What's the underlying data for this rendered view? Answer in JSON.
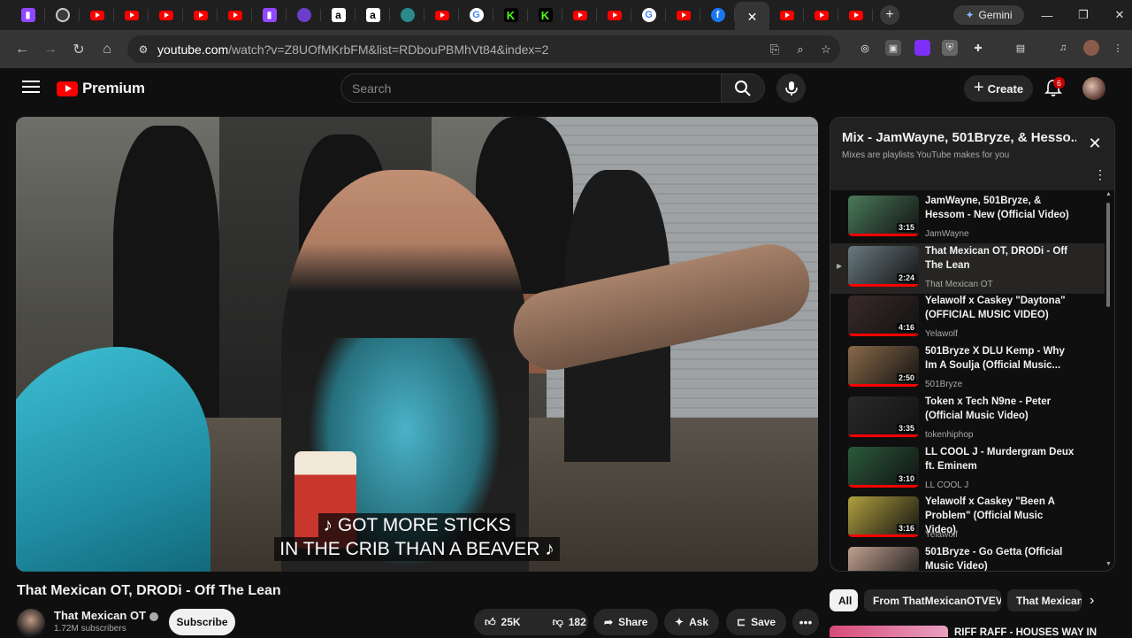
{
  "browser": {
    "tabs": [
      {
        "icon": "twitch-icon"
      },
      {
        "icon": "info-icon"
      },
      {
        "icon": "youtube-icon"
      },
      {
        "icon": "youtube-icon"
      },
      {
        "icon": "youtube-icon"
      },
      {
        "icon": "youtube-icon"
      },
      {
        "icon": "youtube-icon"
      },
      {
        "icon": "twitch-icon"
      },
      {
        "icon": "purple-circle-icon"
      },
      {
        "icon": "amazon-icon"
      },
      {
        "icon": "amazon-icon"
      },
      {
        "icon": "teal-globe-icon"
      },
      {
        "icon": "youtube-icon"
      },
      {
        "icon": "google-icon"
      },
      {
        "icon": "kick-icon"
      },
      {
        "icon": "kick-icon"
      },
      {
        "icon": "youtube-icon"
      },
      {
        "icon": "youtube-icon"
      },
      {
        "icon": "google-icon"
      },
      {
        "icon": "youtube-icon"
      },
      {
        "icon": "facebook-icon"
      }
    ],
    "active_tab_close": "✕",
    "tabs_after": [
      {
        "icon": "youtube-icon"
      },
      {
        "icon": "youtube-icon"
      },
      {
        "icon": "youtube-icon"
      }
    ],
    "new_tab": "+",
    "gemini_label": "Gemini",
    "url_host": "youtube.com",
    "url_rest": "/watch?v=Z8UOfMKrbFM&list=RDbouPBMhVt84&index=2"
  },
  "header": {
    "logo_text": "Premium",
    "search_placeholder": "Search",
    "create_label": "Create",
    "notification_count": "6"
  },
  "video": {
    "caption_line1": "♪ GOT MORE STICKS",
    "caption_line2": "IN THE CRIB THAN A BEAVER ♪",
    "title": "That Mexican OT, DRODi - Off The Lean",
    "channel": "That Mexican OT",
    "subscribers": "1.72M subscribers",
    "subscribe_label": "Subscribe",
    "likes": "25K",
    "dislikes": "182",
    "share_label": "Share",
    "ask_label": "Ask",
    "save_label": "Save"
  },
  "playlist": {
    "title": "Mix - JamWayne, 501Bryze, & Hesso...",
    "subtitle": "Mixes are playlists YouTube makes for you",
    "items": [
      {
        "title": "JamWayne, 501Bryze, & Hessom - New (Official Video)",
        "channel": "JamWayne",
        "duration": "3:15",
        "thumb": "#4a7a5a",
        "current": false
      },
      {
        "title": "That Mexican OT, DRODi - Off The Lean",
        "channel": "That Mexican OT",
        "duration": "2:24",
        "thumb": "#6a7a80",
        "current": true
      },
      {
        "title": "Yelawolf x Caskey \"Daytona\" (OFFICIAL MUSIC VIDEO)",
        "channel": "Yelawolf",
        "duration": "4:16",
        "thumb": "#3a2a2a",
        "current": false
      },
      {
        "title": "501Bryze X DLU Kemp - Why Im A Soulja (Official Music...",
        "channel": "501Bryze",
        "duration": "2:50",
        "thumb": "#8a6a4a",
        "current": false
      },
      {
        "title": "Token x Tech N9ne - Peter (Official Music Video)",
        "channel": "tokenhiphop",
        "duration": "3:35",
        "thumb": "#2a2a2a",
        "current": false
      },
      {
        "title": "LL COOL J - Murdergram Deux ft. Eminem",
        "channel": "LL COOL J",
        "duration": "3:10",
        "thumb": "#2a5a3a",
        "current": false
      },
      {
        "title": "Yelawolf x Caskey \"Been A Problem\" (Official Music Video)",
        "channel": "Yelawolf",
        "duration": "3:16",
        "thumb": "#b0a040",
        "current": false
      },
      {
        "title": "501Bryze - Go Getta (Official Music Video)",
        "channel": "",
        "duration": "",
        "thumb": "#c0a090",
        "current": false
      }
    ]
  },
  "chips": [
    "All",
    "From ThatMexicanOTVEVO",
    "That Mexican"
  ],
  "next_video_title": "RIFF RAFF - HOUSES WAY IN"
}
